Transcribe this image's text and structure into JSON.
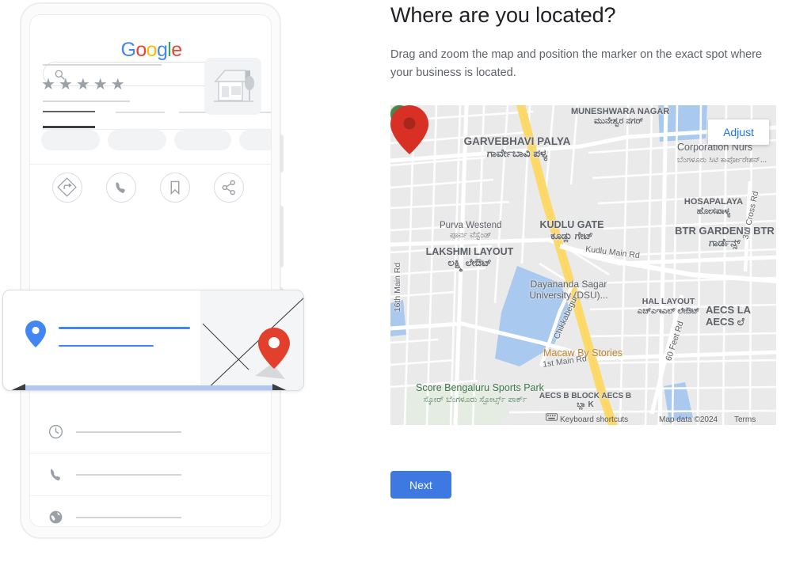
{
  "form": {
    "headline": "Where are you located?",
    "subtext": "Drag and zoom the map and position the marker on the exact spot where your business is located.",
    "next_label": "Next"
  },
  "map": {
    "adjust_label": "Adjust",
    "keyboard_shortcuts": "Keyboard shortcuts",
    "map_data": "Map data ©2024",
    "terms": "Terms",
    "marker_color": "#d93025",
    "park_pin_color": "#3f7a4b",
    "labels": [
      {
        "en": "MUNESHWARA NAGAR",
        "kn": "ಮುನೇಶ್ವರ ನಗರ್"
      },
      {
        "en": "GARVEBHAVI PALYA",
        "kn": "ಗಾರ್ವೇಬಾವಿ ಪಳ್ಯ"
      },
      {
        "en": "HOSAPALAYA",
        "kn": "ಹೋಸಪಾಳ್ಯ"
      },
      {
        "en": "BTR GARDENS BTR",
        "kn": "ಗಾರ್ಡೆನ್ಸ್"
      },
      {
        "en": "LAKSHMI LAYOUT",
        "kn": "ಲಕ್ಷ್ಮಿ ಲೇಔಟ್"
      },
      {
        "en": "HAL LAYOUT",
        "kn": "ಎಚ್ಎಇಎಲ್ ಲೇಔಟ್"
      },
      {
        "en": "AECS LA",
        "kn": "AECS ಲೆ"
      },
      {
        "en": "AECS B BLOCK AECS B",
        "kn": "ಬ್ಲಾ K"
      },
      {
        "en": "KUDLU GATE",
        "kn": "ಕೂಡ್ಲು ಗೇಟ್"
      }
    ],
    "pois": [
      {
        "name": "Purva Westend",
        "kn": "ಪೂರ್ವ ವೆಸ್ಟೆಂಡ್"
      },
      {
        "name": "Dayananda Sagar University (DSU)...",
        "kn": ""
      },
      {
        "name": "Corporation Nurs",
        "kn": "ಬೆಂಗಳೂರು ಸಿಟಿ ಕಾರ್ಪೋರೇಶನ್..."
      },
      {
        "name": "Macaw By Stories",
        "kn": ""
      },
      {
        "name": "Score Bengaluru Sports Park",
        "kn": "ಸ್ಕೋರ್ ಬೆಂಗಳೂರು ಸ್ಪೋರ್ಟ್ಸ್ ಪಾರ್ಕ್"
      }
    ],
    "roads": [
      "Kudlu Main Rd",
      "16th Main Rd",
      "3rd Cross Rd",
      "60 Feet Rd",
      "1st Main Rd",
      "Chikkabegur"
    ]
  },
  "phone": {
    "brand": {
      "g1": "G",
      "o1": "o",
      "o2": "o",
      "g2": "g",
      "l": "l",
      "e": "e"
    },
    "search_placeholder": "",
    "rating_stars": "★★★★★",
    "action_icons": [
      "directions-icon",
      "call-icon",
      "save-icon",
      "share-icon"
    ],
    "detail_rows": [
      "hours-icon",
      "phone-icon",
      "website-icon"
    ],
    "card": {
      "pin_primary_color": "#4285F4",
      "pin_secondary_color": "#d93025"
    }
  }
}
